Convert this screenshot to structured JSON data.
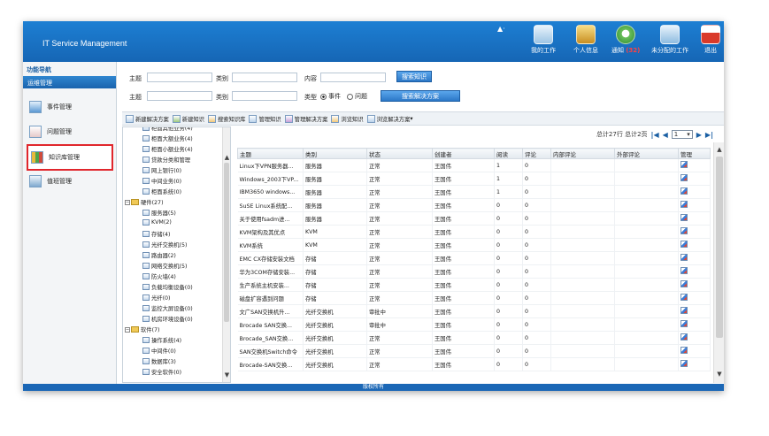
{
  "header": {
    "app_title": "IT Service Management",
    "user_indicator": "▲·",
    "nav": [
      {
        "label": "我的工作",
        "icon": "work-icon"
      },
      {
        "label": "个人信息",
        "icon": "profile-icon"
      },
      {
        "label": "通知",
        "count": "(32)",
        "icon": "notify-icon"
      },
      {
        "label": "未分配的工作",
        "icon": "unassigned-icon"
      },
      {
        "label": "退出",
        "icon": "exit-icon"
      }
    ]
  },
  "sidebar": {
    "title": "功能导航",
    "section": "运维管理",
    "items": [
      {
        "label": "事件管理"
      },
      {
        "label": "问题管理"
      },
      {
        "label": "知识库管理"
      },
      {
        "label": "值班管理"
      }
    ]
  },
  "search": {
    "row1": {
      "subject_label": "主题",
      "category_label": "类别",
      "content_label": "内容",
      "button": "搜索知识"
    },
    "row2": {
      "subject_label": "主题",
      "category_label": "类别",
      "type_label": "类型",
      "option_event": "事件",
      "option_problem": "问题",
      "button": "搜索解决方案"
    }
  },
  "toolbar": [
    "新建解决方案",
    "新建知识",
    "搜索知识库",
    "管理知识",
    "管理解决方案",
    "浏览知识",
    "浏览解决方案"
  ],
  "tree": {
    "nodes": [
      {
        "label": "柜面其他业务(4)",
        "type": "leaf",
        "level": 2
      },
      {
        "label": "柜面大额业务(4)",
        "type": "leaf",
        "level": 2
      },
      {
        "label": "柜面小额业务(4)",
        "type": "leaf",
        "level": 2
      },
      {
        "label": "贷款分类和管理",
        "type": "leaf",
        "level": 2
      },
      {
        "label": "网上银行(0)",
        "type": "leaf",
        "level": 2
      },
      {
        "label": "中间业务(0)",
        "type": "leaf",
        "level": 2
      },
      {
        "label": "柜面系统(0)",
        "type": "leaf",
        "level": 2
      },
      {
        "label": "硬件(27)",
        "type": "folder",
        "level": 1
      },
      {
        "label": "服务器(5)",
        "type": "leaf",
        "level": 2
      },
      {
        "label": "KVM(2)",
        "type": "leaf",
        "level": 2
      },
      {
        "label": "存储(4)",
        "type": "leaf",
        "level": 2
      },
      {
        "label": "光纤交换机(5)",
        "type": "leaf",
        "level": 2
      },
      {
        "label": "路由器(2)",
        "type": "leaf",
        "level": 2
      },
      {
        "label": "网络交换机(5)",
        "type": "leaf",
        "level": 2
      },
      {
        "label": "防火墙(4)",
        "type": "leaf",
        "level": 2
      },
      {
        "label": "负载均衡设备(0)",
        "type": "leaf",
        "level": 2
      },
      {
        "label": "光纤(0)",
        "type": "leaf",
        "level": 2
      },
      {
        "label": "监控大屏设备(0)",
        "type": "leaf",
        "level": 2
      },
      {
        "label": "机房环境设备(0)",
        "type": "leaf",
        "level": 2
      },
      {
        "label": "软件(7)",
        "type": "folder",
        "level": 1
      },
      {
        "label": "操作系统(4)",
        "type": "leaf",
        "level": 2
      },
      {
        "label": "中间件(0)",
        "type": "leaf",
        "level": 2
      },
      {
        "label": "数据库(3)",
        "type": "leaf",
        "level": 2
      },
      {
        "label": "安全软件(0)",
        "type": "leaf",
        "level": 2
      }
    ]
  },
  "pager": {
    "summary": "总计27行 总计2页",
    "first": "|◀",
    "prev": "◀",
    "page": "1",
    "next": "▶",
    "last": "▶|"
  },
  "table": {
    "columns": [
      "主题",
      "类别",
      "状态",
      "创建者",
      "阅读",
      "评论",
      "内部评论",
      "外部评论",
      "管理"
    ],
    "rows": [
      [
        "Linux下VPN服务器...",
        "服务器",
        "正常",
        "王国伟",
        "1",
        "0",
        "",
        ""
      ],
      [
        "Windows_2003下VP...",
        "服务器",
        "正常",
        "王国伟",
        "1",
        "0",
        "",
        ""
      ],
      [
        "IBM3650 windows...",
        "服务器",
        "正常",
        "王国伟",
        "1",
        "0",
        "",
        ""
      ],
      [
        "SuSE Linux系统配...",
        "服务器",
        "正常",
        "王国伟",
        "0",
        "0",
        "",
        ""
      ],
      [
        "关于使用fsadm进...",
        "服务器",
        "正常",
        "王国伟",
        "0",
        "0",
        "",
        ""
      ],
      [
        "KVM架构及其优点",
        "KVM",
        "正常",
        "王国伟",
        "0",
        "0",
        "",
        ""
      ],
      [
        "KVM系统",
        "KVM",
        "正常",
        "王国伟",
        "0",
        "0",
        "",
        ""
      ],
      [
        "EMC CX存储安装文档",
        "存储",
        "正常",
        "王国伟",
        "0",
        "0",
        "",
        ""
      ],
      [
        "华为3COM存储安装...",
        "存储",
        "正常",
        "王国伟",
        "0",
        "0",
        "",
        ""
      ],
      [
        "生产系统主机安装...",
        "存储",
        "正常",
        "王国伟",
        "0",
        "0",
        "",
        ""
      ],
      [
        "磁盘扩容遇到问题",
        "存储",
        "正常",
        "王国伟",
        "0",
        "0",
        "",
        ""
      ],
      [
        "文广SAN交换机升...",
        "光纤交换机",
        "审批中",
        "王国伟",
        "0",
        "0",
        "",
        ""
      ],
      [
        "Brocade SAN交换...",
        "光纤交换机",
        "审批中",
        "王国伟",
        "0",
        "0",
        "",
        ""
      ],
      [
        "Brocade_SAN交换...",
        "光纤交换机",
        "正常",
        "王国伟",
        "0",
        "0",
        "",
        ""
      ],
      [
        "SAN交换机Switch命令",
        "光纤交换机",
        "正常",
        "王国伟",
        "0",
        "0",
        "",
        ""
      ],
      [
        "Brocade-SAN交换...",
        "光纤交换机",
        "正常",
        "王国伟",
        "0",
        "0",
        "",
        ""
      ]
    ]
  },
  "footer": "版权所有"
}
